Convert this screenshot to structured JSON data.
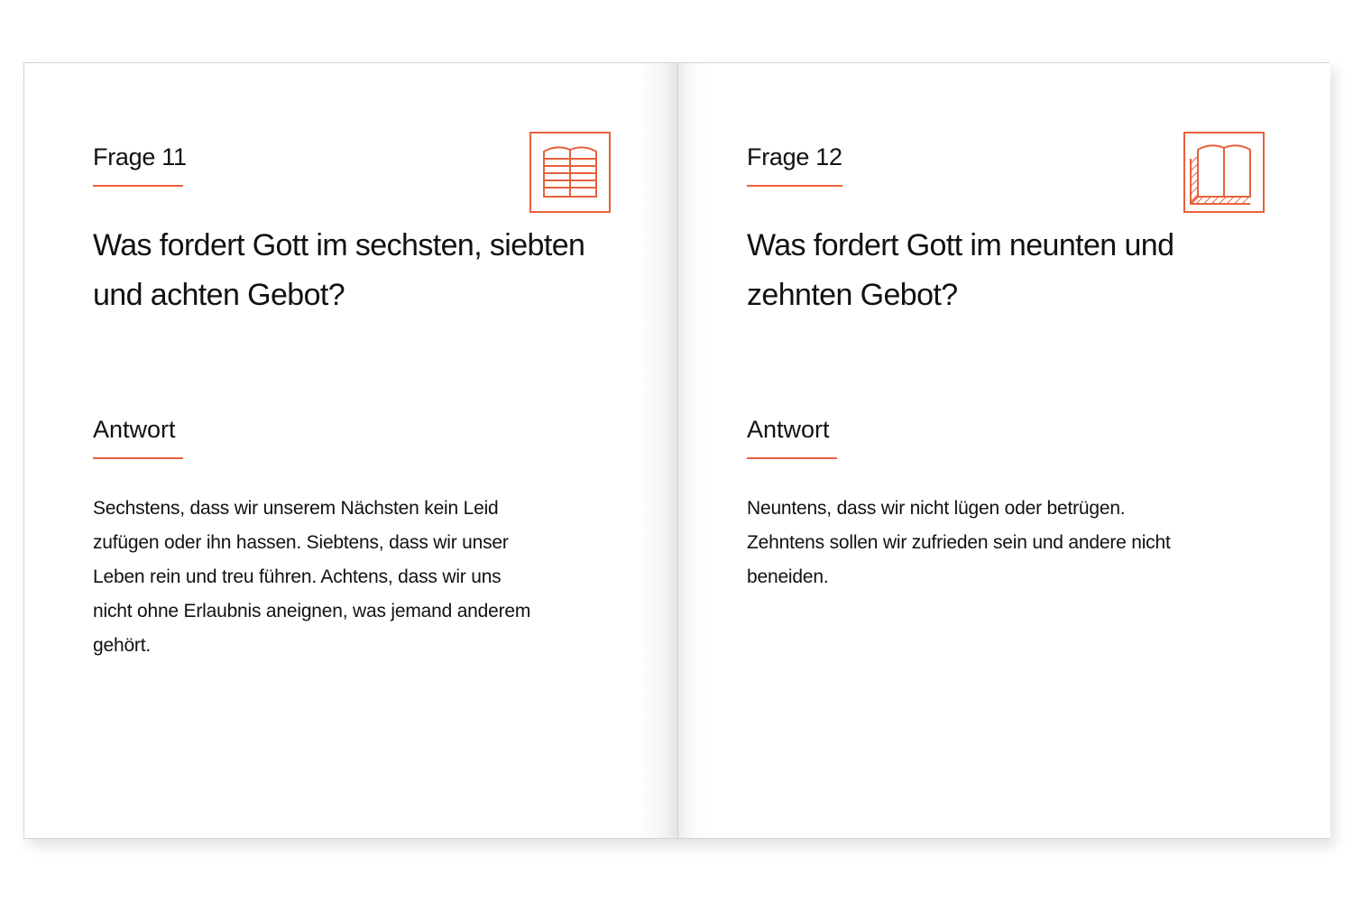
{
  "pages": [
    {
      "question_label": "Frage 11",
      "question": "Was fordert Gott im sechsten, siebten und achten Gebot?",
      "answer_label": "Antwort",
      "answer": "Sechstens, dass wir unserem Nächsten kein Leid zufügen oder ihn hassen. Siebtens, dass wir unser Leben rein und treu führen. Achtens, dass wir uns nicht ohne Erlaubnis aneignen, was jemand anderem gehört.",
      "icon": "open-book-lined-icon"
    },
    {
      "question_label": "Frage 12",
      "question": "Was fordert Gott im neunten und zehnten Gebot?",
      "answer_label": "Antwort",
      "answer": "Neuntens, dass wir nicht lügen oder betrügen. Zehntens sollen wir zufrieden sein und andere nicht beneiden.",
      "icon": "open-book-hatched-icon"
    }
  ],
  "colors": {
    "accent": "#e8603c",
    "text": "#111111"
  }
}
